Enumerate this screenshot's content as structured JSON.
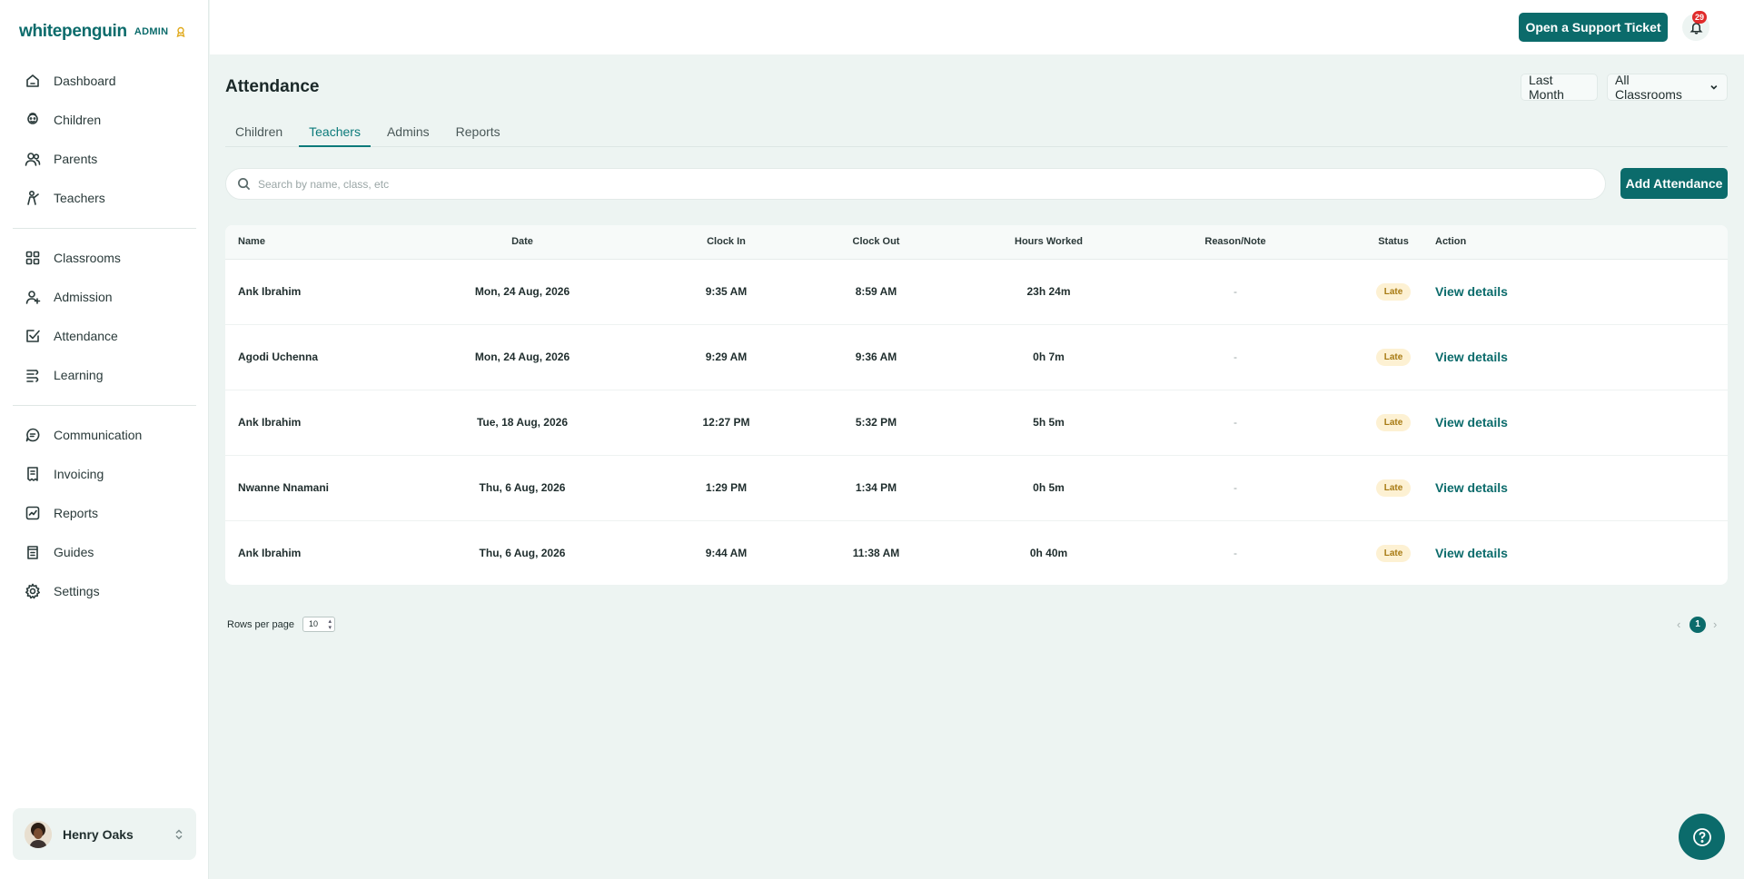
{
  "brand": {
    "logo": "whitepenguin",
    "role": "ADMIN"
  },
  "sidebar": {
    "group1": [
      {
        "label": "Dashboard",
        "icon": "home-icon"
      },
      {
        "label": "Children",
        "icon": "children-icon"
      },
      {
        "label": "Parents",
        "icon": "parents-icon"
      },
      {
        "label": "Teachers",
        "icon": "teachers-icon"
      }
    ],
    "group2": [
      {
        "label": "Classrooms",
        "icon": "classrooms-icon"
      },
      {
        "label": "Admission",
        "icon": "admission-icon"
      },
      {
        "label": "Attendance",
        "icon": "attendance-icon"
      },
      {
        "label": "Learning",
        "icon": "learning-icon"
      }
    ],
    "group3": [
      {
        "label": "Communication",
        "icon": "chat-icon"
      },
      {
        "label": "Invoicing",
        "icon": "invoice-icon"
      },
      {
        "label": "Reports",
        "icon": "reports-icon"
      },
      {
        "label": "Guides",
        "icon": "guides-icon"
      },
      {
        "label": "Settings",
        "icon": "gear-icon"
      }
    ],
    "user": {
      "name": "Henry Oaks"
    }
  },
  "topbar": {
    "support_label": "Open a Support Ticket",
    "notification_count": "29"
  },
  "page": {
    "title": "Attendance",
    "filters": {
      "period": "Last Month",
      "classroom": "All Classrooms"
    },
    "tabs": [
      "Children",
      "Teachers",
      "Admins",
      "Reports"
    ],
    "active_tab": "Teachers",
    "search_placeholder": "Search by name, class, etc",
    "add_label": "Add Attendance"
  },
  "table": {
    "headers": [
      "Name",
      "Date",
      "Clock In",
      "Clock Out",
      "Hours Worked",
      "Reason/Note",
      "Status",
      "Action"
    ],
    "rows": [
      {
        "name": "Ank Ibrahim",
        "date": "Mon, 24 Aug, 2026",
        "clock_in": "9:35 AM",
        "clock_out": "8:59 AM",
        "hours": "23h 24m",
        "note": "-",
        "status": "Late",
        "action": "View details"
      },
      {
        "name": "Agodi Uchenna",
        "date": "Mon, 24 Aug, 2026",
        "clock_in": "9:29 AM",
        "clock_out": "9:36 AM",
        "hours": "0h 7m",
        "note": "-",
        "status": "Late",
        "action": "View details"
      },
      {
        "name": "Ank Ibrahim",
        "date": "Tue, 18 Aug, 2026",
        "clock_in": "12:27 PM",
        "clock_out": "5:32 PM",
        "hours": "5h 5m",
        "note": "-",
        "status": "Late",
        "action": "View details"
      },
      {
        "name": "Nwanne Nnamani",
        "date": "Thu, 6 Aug, 2026",
        "clock_in": "1:29 PM",
        "clock_out": "1:34 PM",
        "hours": "0h 5m",
        "note": "-",
        "status": "Late",
        "action": "View details"
      },
      {
        "name": "Ank Ibrahim",
        "date": "Thu, 6 Aug, 2026",
        "clock_in": "9:44 AM",
        "clock_out": "11:38 AM",
        "hours": "0h 40m",
        "note": "-",
        "status": "Late",
        "action": "View details"
      }
    ]
  },
  "pagination": {
    "rows_label": "Rows per page",
    "rows_value": "10",
    "current_page": "1",
    "prev": "‹",
    "next": "›"
  },
  "colors": {
    "primary": "#0b6b6b",
    "background": "#edf4f2",
    "late_badge_bg": "#fdf1d3",
    "late_badge_text": "#a77a12",
    "notification": "#e02b2b"
  }
}
